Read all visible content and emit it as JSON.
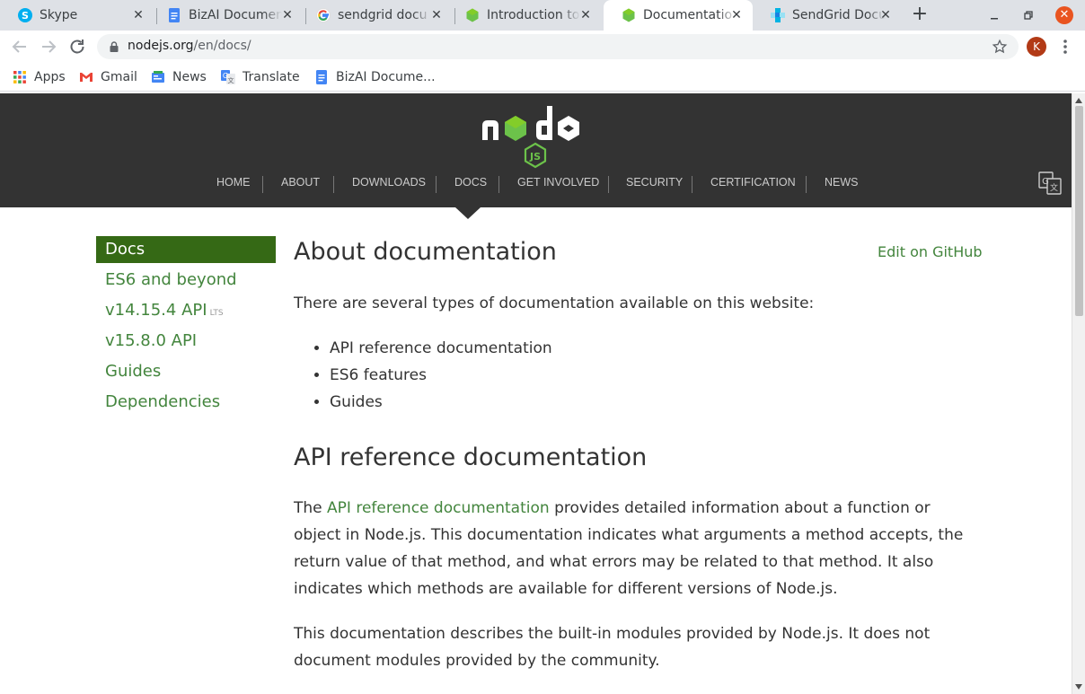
{
  "browser": {
    "tabs": [
      {
        "title": "Skype",
        "icon": "skype-icon",
        "active": false
      },
      {
        "title": "BizAI Documen",
        "icon": "docs-icon",
        "active": false
      },
      {
        "title": "sendgrid docu",
        "icon": "google-icon",
        "active": false
      },
      {
        "title": "Introduction to",
        "icon": "nodejs-icon",
        "active": false
      },
      {
        "title": "Documentatio",
        "icon": "nodejs-icon",
        "active": true
      },
      {
        "title": "SendGrid Docu",
        "icon": "sendgrid-icon",
        "active": false
      }
    ],
    "close_glyph": "✕",
    "new_tab_glyph": "+",
    "url_host": "nodejs.org",
    "url_path": "/en/docs/",
    "profile_initial": "K",
    "bookmarks": [
      {
        "label": "Apps",
        "icon": "apps-grid-icon"
      },
      {
        "label": "Gmail",
        "icon": "gmail-icon"
      },
      {
        "label": "News",
        "icon": "news-icon"
      },
      {
        "label": "Translate",
        "icon": "translate-icon"
      },
      {
        "label": "BizAI Docume...",
        "icon": "docs-icon"
      }
    ]
  },
  "site": {
    "nav": [
      "HOME",
      "ABOUT",
      "DOWNLOADS",
      "DOCS",
      "GET INVOLVED",
      "SECURITY",
      "CERTIFICATION",
      "NEWS"
    ],
    "active_nav": "DOCS",
    "sidebar": [
      {
        "label": "Docs",
        "active": true
      },
      {
        "label": "ES6 and beyond",
        "active": false
      },
      {
        "label": "v14.15.4 API",
        "badge": "LTS",
        "active": false
      },
      {
        "label": "v15.8.0 API",
        "active": false
      },
      {
        "label": "Guides",
        "active": false
      },
      {
        "label": "Dependencies",
        "active": false
      }
    ]
  },
  "content": {
    "title": "About documentation",
    "edit_link": "Edit on GitHub",
    "intro": "There are several types of documentation available on this website:",
    "bullets": [
      "API reference documentation",
      "ES6 features",
      "Guides"
    ],
    "section_title": "API reference documentation",
    "para1_prefix": "The ",
    "para1_link": "API reference documentation",
    "para1_rest": " provides detailed information about a function or object in Node.js. This documentation indicates what arguments a method accepts, the return value of that method, and what errors may be related to that method. It also indicates which methods are available for different versions of Node.js.",
    "para2": "This documentation describes the built-in modules provided by Node.js. It does not document modules provided by the community."
  },
  "colors": {
    "node_green": "#43853d",
    "sidebar_active_bg": "#356915",
    "header_bg": "#333333",
    "tabstrip_bg": "#dee1e6"
  }
}
